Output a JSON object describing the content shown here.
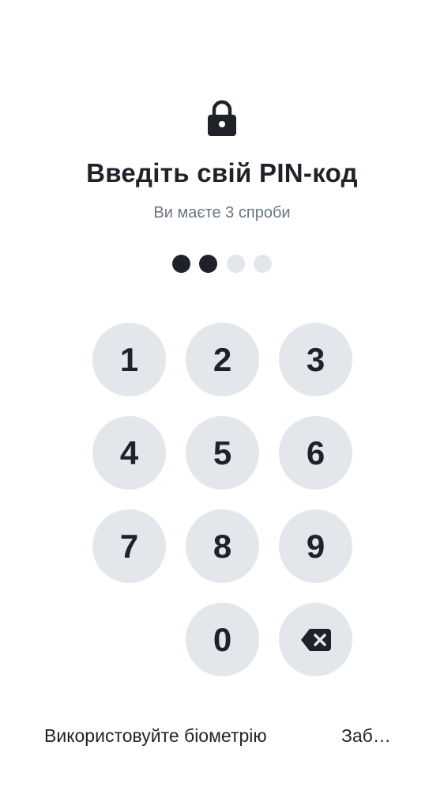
{
  "header": {
    "lock_icon": "lock-icon",
    "title": "Введіть свій PIN-код",
    "subtitle": "Ви маєте 3 спроби"
  },
  "pin": {
    "length": 4,
    "entered": 2
  },
  "keypad": {
    "keys": [
      "1",
      "2",
      "3",
      "4",
      "5",
      "6",
      "7",
      "8",
      "9",
      "0"
    ],
    "backspace_icon": "backspace-icon"
  },
  "footer": {
    "biometric_label": "Використовуйте біометрію",
    "forgot_label": "Заб…"
  },
  "colors": {
    "text": "#1f2329",
    "subtitle": "#6b7583",
    "key_bg": "#e3e6eb",
    "dot_empty": "#e3e6eb",
    "dot_filled": "#1f2329"
  }
}
